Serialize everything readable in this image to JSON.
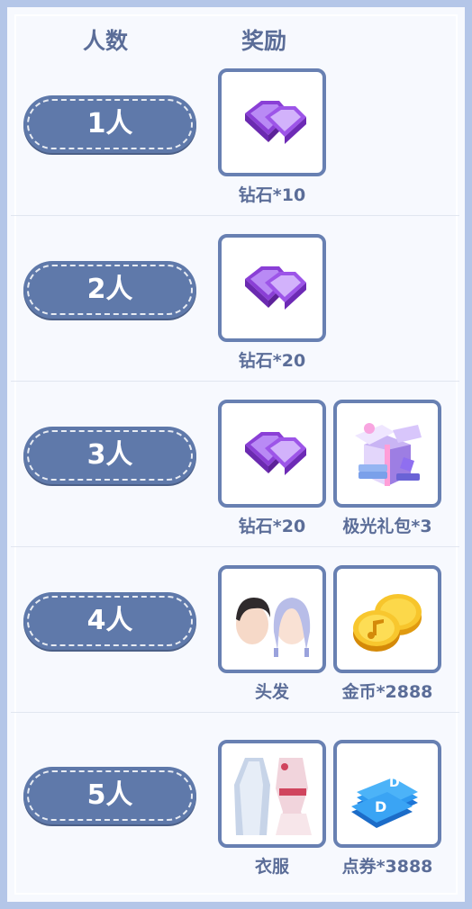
{
  "header": {
    "count_label": "人数",
    "reward_label": "奖励"
  },
  "rows": [
    {
      "count": "1人",
      "rewards": [
        {
          "icon": "diamond-icon",
          "label": "钻石*10"
        }
      ]
    },
    {
      "count": "2人",
      "rewards": [
        {
          "icon": "diamond-icon",
          "label": "钻石*20"
        }
      ]
    },
    {
      "count": "3人",
      "rewards": [
        {
          "icon": "diamond-icon",
          "label": "钻石*20"
        },
        {
          "icon": "gift-pack-icon",
          "label": "极光礼包*3"
        }
      ]
    },
    {
      "count": "4人",
      "rewards": [
        {
          "icon": "hair-icon",
          "label": "头发"
        },
        {
          "icon": "gold-coin-icon",
          "label": "金币*2888"
        }
      ]
    },
    {
      "count": "5人",
      "rewards": [
        {
          "icon": "clothes-icon",
          "label": "衣服"
        },
        {
          "icon": "voucher-icon",
          "label": "点券*3888"
        }
      ]
    }
  ],
  "colors": {
    "pill": "#5f79aa",
    "tile_border": "#6880b2",
    "label_text": "#5b6d98",
    "frame": "#b4c6e8"
  }
}
